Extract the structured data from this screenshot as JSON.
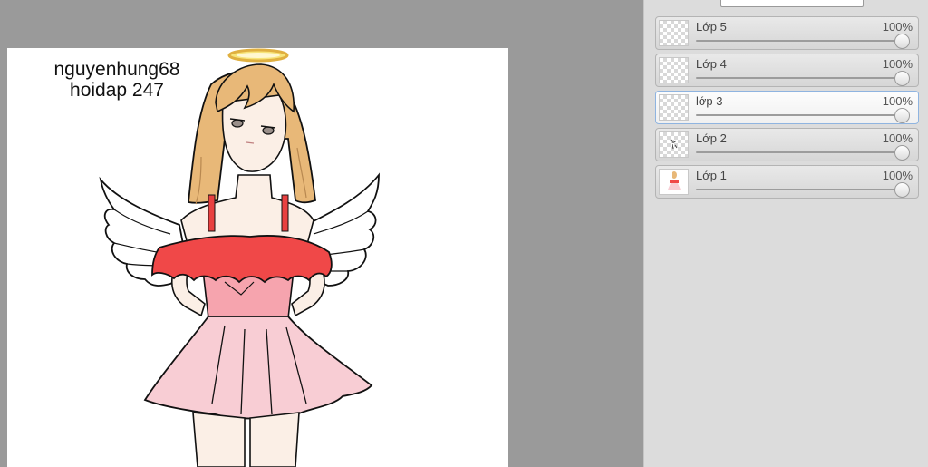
{
  "canvas": {
    "watermark_line1": "nguyenhung68",
    "watermark_line2": "hoidap 247"
  },
  "layers_panel": {
    "layers": [
      {
        "name": "Lớp 5",
        "opacity": "100%",
        "opacity_value": 100,
        "active": false,
        "thumb": "empty"
      },
      {
        "name": "Lớp 4",
        "opacity": "100%",
        "opacity_value": 100,
        "active": false,
        "thumb": "empty"
      },
      {
        "name": "lớp 3",
        "opacity": "100%",
        "opacity_value": 100,
        "active": true,
        "thumb": "empty"
      },
      {
        "name": "Lớp 2",
        "opacity": "100%",
        "opacity_value": 100,
        "active": false,
        "thumb": "sketch"
      },
      {
        "name": "Lớp 1",
        "opacity": "100%",
        "opacity_value": 100,
        "active": false,
        "thumb": "drawing"
      }
    ]
  },
  "colors": {
    "workspace_bg": "#9a9a9a",
    "panel_bg": "#dcdcdc",
    "active_layer_border": "#8fb4e0",
    "dress_top": "#f04848",
    "dress_skirt": "#f8cdd4",
    "hair": "#e8b878",
    "skin": "#fbefe6"
  }
}
